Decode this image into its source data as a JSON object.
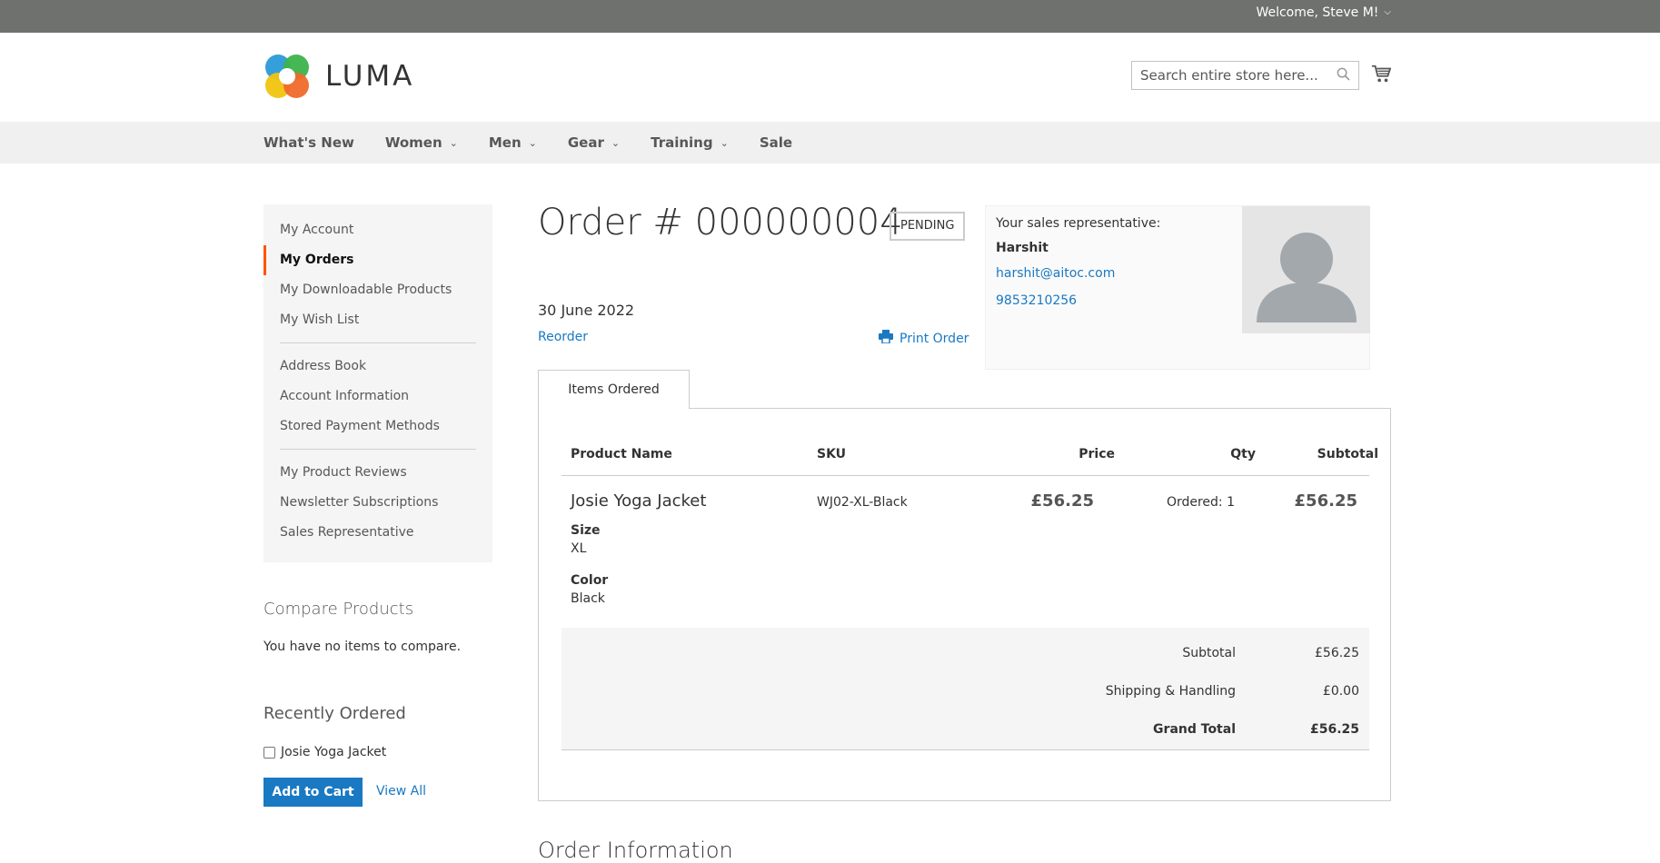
{
  "topbar": {
    "welcome": "Welcome, Steve M!"
  },
  "header": {
    "logo_text": "LUMA",
    "search_placeholder": "Search entire store here..."
  },
  "nav": [
    "What's New",
    "Women",
    "Men",
    "Gear",
    "Training",
    "Sale"
  ],
  "sidebar": {
    "group1": [
      "My Account",
      "My Orders",
      "My Downloadable Products",
      "My Wish List"
    ],
    "group2": [
      "Address Book",
      "Account Information",
      "Stored Payment Methods"
    ],
    "group3": [
      "My Product Reviews",
      "Newsletter Subscriptions",
      "Sales Representative"
    ],
    "active": "My Orders"
  },
  "compare": {
    "title": "Compare Products",
    "text": "You have no items to compare."
  },
  "recent": {
    "title": "Recently Ordered",
    "item": "Josie Yoga Jacket",
    "add_to_cart": "Add to Cart",
    "view_all": "View All"
  },
  "order": {
    "title": "Order # 000000004",
    "status": "PENDING",
    "date": "30 June 2022",
    "reorder": "Reorder",
    "print": "Print Order"
  },
  "rep": {
    "label": "Your sales representative:",
    "name": "Harshit",
    "email": "harshit@aitoc.com",
    "phone": "9853210256"
  },
  "items": {
    "tab": "Items Ordered",
    "headers": {
      "name": "Product Name",
      "sku": "SKU",
      "price": "Price",
      "qty": "Qty",
      "subtotal": "Subtotal"
    },
    "row": {
      "name": "Josie Yoga Jacket",
      "size_label": "Size",
      "size": "XL",
      "color_label": "Color",
      "color": "Black",
      "sku": "WJ02-XL-Black",
      "price": "£56.25",
      "qty": "Ordered: 1",
      "subtotal": "£56.25"
    },
    "totals": {
      "subtotal_label": "Subtotal",
      "subtotal": "£56.25",
      "shipping_label": "Shipping & Handling",
      "shipping": "£0.00",
      "grand_label": "Grand Total",
      "grand": "£56.25"
    }
  },
  "order_info": "Order Information"
}
